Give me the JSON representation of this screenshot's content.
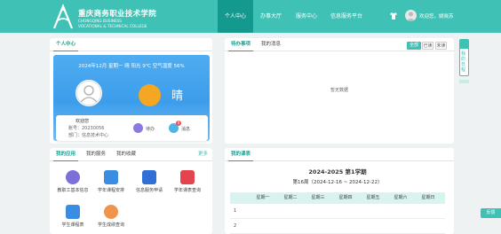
{
  "header": {
    "school_name_cn": "重庆商务职业技术学院",
    "school_name_en_1": "CHONGQING BUSINESS",
    "school_name_en_2": "VOCATIONAL & TECHNICAL COLLEGE",
    "nav": [
      {
        "label": "个人中心",
        "active": true
      },
      {
        "label": "办事大厅",
        "active": false
      },
      {
        "label": "服务中心",
        "active": false
      },
      {
        "label": "信息服务平台",
        "active": false
      }
    ],
    "user_label": "欢迎您，姚晓苏"
  },
  "profile": {
    "tab_label": "个人中心",
    "date_line": "2024年12月 星期一   晴   阳光 9℃  空气湿度 56%",
    "weather_text": "晴",
    "name_label": "欢迎您",
    "id_line": "账号：20230056",
    "dept_line": "部门：信息技术中心",
    "action_1": "待办",
    "action_2": "消息",
    "badge_count": "0"
  },
  "messages": {
    "tabs": [
      "待办事项",
      "我的消息"
    ],
    "btn_all": "全部",
    "btn_read": "已读",
    "btn_unread": "未读",
    "empty_text": "暂无数据"
  },
  "apps_panel": {
    "tabs": [
      "我的应用",
      "我的服务",
      "我的收藏"
    ],
    "more": "更多",
    "apps": [
      {
        "label": "教职工基本信息",
        "color": "#7c6fd8"
      },
      {
        "label": "学年课程安排",
        "color": "#3a8de0"
      },
      {
        "label": "信息服务申请",
        "color": "#2f6fd6"
      },
      {
        "label": "学年课表查询",
        "color": "#e5434d"
      },
      {
        "label": "学生课程表",
        "color": "#3a8de0"
      },
      {
        "label": "学生成绩查询",
        "color": "#f0944b"
      }
    ]
  },
  "schedule": {
    "tab_label": "我的课表",
    "term_title": "2024-2025 第1学期",
    "week_line": "第16周（2024-12-16 ~ 2024-12-22）",
    "days": [
      "星期一",
      "星期二",
      "星期三",
      "星期四",
      "星期五",
      "星期六",
      "星期日"
    ],
    "rows": [
      "1",
      "2"
    ]
  },
  "sidebar": {
    "side_tab_text": "我的日程",
    "feedback": "反馈"
  },
  "colors": {
    "brand": "#3fc1b5",
    "brand_dark": "#13998d",
    "card_blue": "#4facf0"
  }
}
